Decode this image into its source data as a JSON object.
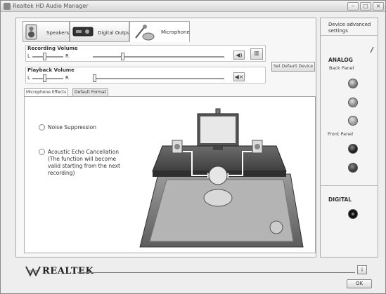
{
  "window": {
    "title": "Realtek HD Audio Manager",
    "controls": [
      "–",
      "□",
      "×"
    ]
  },
  "device_tabs": [
    {
      "label": "Speakers",
      "icon": "speakers-icon",
      "active": false
    },
    {
      "label": "Digital Output",
      "icon": "digital-output-icon",
      "active": false
    },
    {
      "label": "Microphone",
      "icon": "microphone-icon",
      "active": true
    }
  ],
  "recording_volume": {
    "title": "Recording Volume",
    "left_label": "L",
    "right_label": "R",
    "balance": 0.5,
    "level": 0.27
  },
  "playback_volume": {
    "title": "Playback Volume",
    "left_label": "L",
    "right_label": "R",
    "balance": 0.5,
    "level": 0.0
  },
  "set_default_label": "Set Default Device",
  "sub_tabs": [
    {
      "label": "Microphone Effects",
      "active": true
    },
    {
      "label": "Default Format",
      "active": false
    }
  ],
  "effects": {
    "noise_suppression": "Noise Suppression",
    "aec_lines": [
      "Acoustic Echo Cancellation",
      "(The function will become",
      "valid starting from the next",
      "recording)"
    ]
  },
  "side": {
    "advanced_lines": [
      "Device advanced",
      "settings"
    ],
    "analog_title": "ANALOG",
    "back_panel": "Back Panel",
    "front_panel": "Front Panel",
    "digital_title": "DIGITAL"
  },
  "jack_colors": {
    "back": [
      "#7a7a7a",
      "#8a8a8a",
      "#9c9c9c"
    ],
    "front": [
      "#1a1a1a",
      "#3a3a3a"
    ],
    "digital": "#111111"
  },
  "footer": {
    "brand": "REALTEK",
    "info": "i",
    "ok": "OK"
  }
}
